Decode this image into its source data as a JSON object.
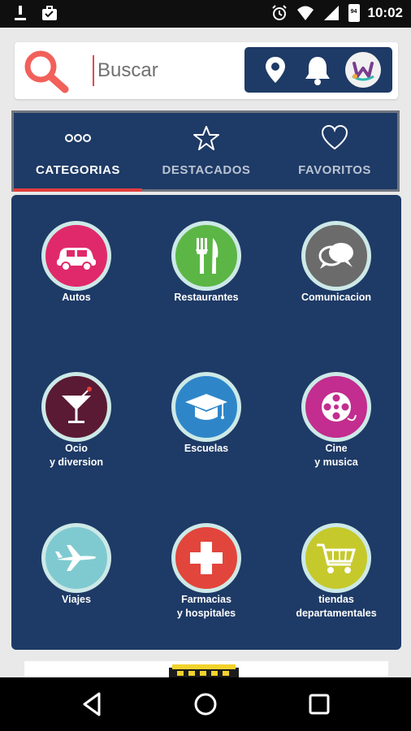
{
  "status_bar": {
    "time": "10:02",
    "left_icons": [
      "download-icon",
      "briefcase-icon"
    ],
    "right_icons": [
      "alarm-icon",
      "wifi-icon",
      "signal-icon",
      "battery-icon"
    ],
    "battery_level": "94"
  },
  "search": {
    "placeholder": "Buscar",
    "value": ""
  },
  "header_actions": [
    "location-icon",
    "bell-icon",
    "avatar"
  ],
  "tabs": [
    {
      "label": "CATEGORIAS",
      "icon": "three-dots-icon",
      "active": true
    },
    {
      "label": "DESTACADOS",
      "icon": "star-icon",
      "active": false
    },
    {
      "label": "FAVORITOS",
      "icon": "heart-icon",
      "active": false
    }
  ],
  "categories": [
    {
      "label": "Autos",
      "icon": "car-icon",
      "color": "#e0296a"
    },
    {
      "label": "Restaurantes",
      "icon": "fork-knife-icon",
      "color": "#5cb646"
    },
    {
      "label": "Comunicacion",
      "icon": "speech-bubbles-icon",
      "color": "#6b6b6b"
    },
    {
      "label_line1": "Ocio",
      "label_line2": "y diversion",
      "icon": "cocktail-icon",
      "color": "#5a1a33"
    },
    {
      "label": "Escuelas",
      "icon": "graduation-cap-icon",
      "color": "#2e86c9"
    },
    {
      "label_line1": "Cine",
      "label_line2": "y musica",
      "icon": "film-reel-icon",
      "color": "#c22d8f"
    },
    {
      "label": "Viajes",
      "icon": "airplane-icon",
      "color": "#7fcad0"
    },
    {
      "label_line1": "Farmacias",
      "label_line2": "y hospitales",
      "icon": "medical-cross-icon",
      "color": "#e2453b"
    },
    {
      "label_line1": "tiendas",
      "label_line2": "departamentales",
      "icon": "shopping-cart-icon",
      "color": "#c6c92b"
    }
  ],
  "colors": {
    "navy": "#1e3a66",
    "accent_red": "#e23d3d",
    "search_icon": "#f2605a"
  }
}
